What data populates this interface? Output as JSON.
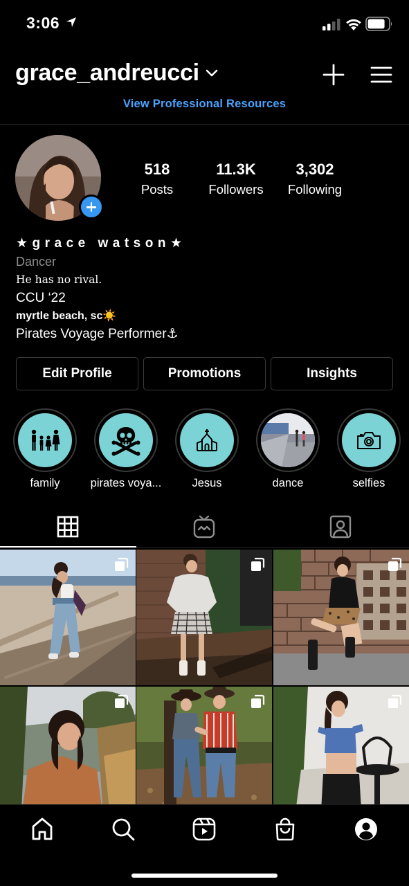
{
  "status_bar": {
    "time": "3:06"
  },
  "header": {
    "username": "grace_andreucci",
    "pro_link": "View Professional Resources"
  },
  "stats": [
    {
      "value": "518",
      "label": "Posts"
    },
    {
      "value": "11.3K",
      "label": "Followers"
    },
    {
      "value": "3,302",
      "label": "Following"
    }
  ],
  "bio": {
    "name": "★grace watson★",
    "category": "Dancer",
    "quote": "He has no rival.",
    "school": "CCU ‘22",
    "location": "myrtle beach, sc☀️",
    "job": "Pirates Voyage Performer⚓"
  },
  "buttons": {
    "edit": "Edit Profile",
    "promotions": "Promotions",
    "insights": "Insights"
  },
  "highlights": [
    {
      "label": "family",
      "icon": "family-icon"
    },
    {
      "label": "pirates voya...",
      "icon": "skull-crossbones-icon"
    },
    {
      "label": "Jesus",
      "icon": "church-icon"
    },
    {
      "label": "dance",
      "icon": "dance-photo"
    },
    {
      "label": "selfies",
      "icon": "camera-icon"
    }
  ],
  "tabs": [
    "grid-icon",
    "igtv-icon",
    "tagged-icon"
  ],
  "colors": {
    "accent": "#3897f0",
    "link": "#4aa3ff",
    "highlight_bg": "#7cd3d6",
    "background": "#000000"
  },
  "bottom_nav": [
    "home-icon",
    "search-icon",
    "reels-icon",
    "shop-icon",
    "profile-icon"
  ]
}
